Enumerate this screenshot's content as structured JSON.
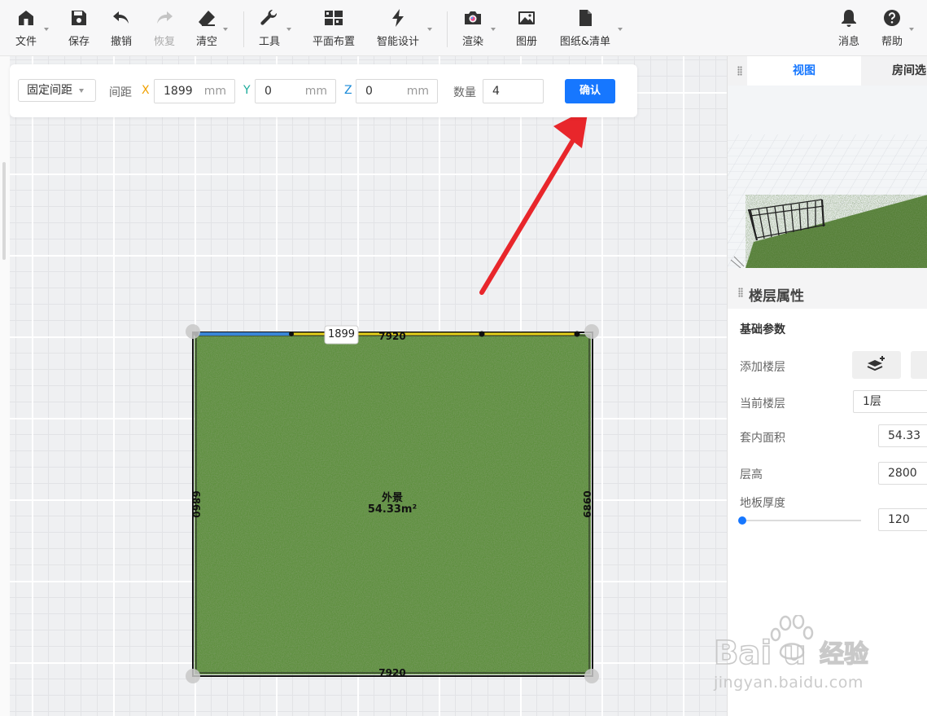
{
  "toolbar": {
    "file": "文件",
    "save": "保存",
    "undo": "撤销",
    "redo": "恢复",
    "clear": "清空",
    "tools": "工具",
    "floorplan": "平面布置",
    "smart_design": "智能设计",
    "render": "渲染",
    "album": "图册",
    "drawings": "图纸&清单",
    "messages": "消息",
    "help": "帮助"
  },
  "array_panel": {
    "mode": "固定间距",
    "spacing_label": "间距",
    "x_axis": "X",
    "x_value": "1899",
    "y_axis": "Y",
    "y_value": "0",
    "z_axis": "Z",
    "z_value": "0",
    "unit": "mm",
    "count_label": "数量",
    "count_value": "4",
    "confirm": "确认"
  },
  "plan": {
    "room_name": "外景",
    "room_area": "54.33m²",
    "top_dimension": "7920",
    "bottom_dimension": "7920",
    "left_dimension": "6860",
    "right_dimension": "6860",
    "selected_length": "1899"
  },
  "right_panel": {
    "tab_view": "视图",
    "tab_room": "房间选",
    "floor_section_title": "楼层属性",
    "basic_params": "基础参数",
    "add_floor_label": "添加楼层",
    "current_floor_label": "当前楼层",
    "current_floor_value": "1层",
    "inner_area_label": "套内面积",
    "inner_area_value": "54.33",
    "floor_height_label": "层高",
    "floor_height_value": "2800",
    "slab_thickness_label": "地板厚度",
    "slab_thickness_value": "120",
    "slab_thickness_slider_fraction": 0.0
  },
  "watermark": {
    "brand": "Baidu经验",
    "url": "jingyan.baidu.com"
  },
  "colors": {
    "accent": "#1677ff",
    "arrow": "#e8262b",
    "x_axis": "#f0a000",
    "y_axis": "#1aaa9a",
    "z_axis": "#1a8ad8",
    "grass": "#5a8c3a"
  }
}
